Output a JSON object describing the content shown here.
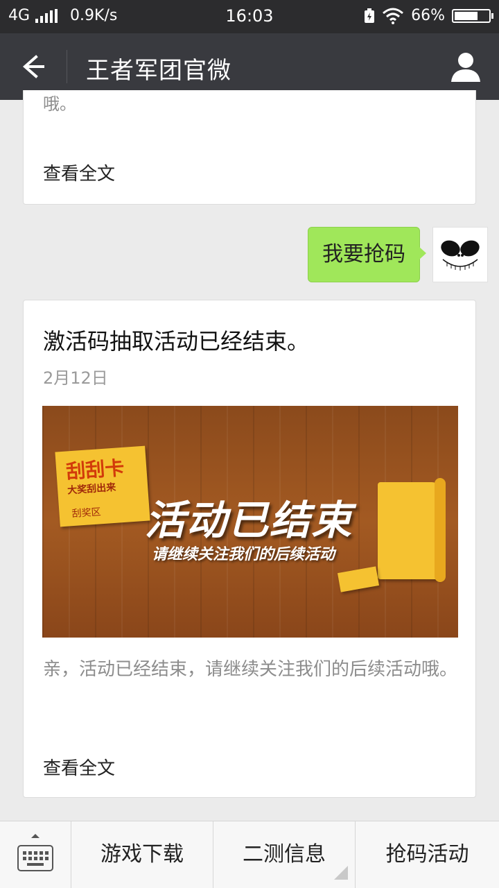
{
  "status_bar": {
    "network": "4G",
    "speed": "0.9K/s",
    "time": "16:03",
    "battery": "66%",
    "battery_level": 0.66
  },
  "header": {
    "title": "王者军团官微",
    "back_icon": "arrow-left-icon",
    "profile_icon": "person-icon"
  },
  "messages": {
    "prev_article": {
      "text_fragment": "哦。",
      "read_more": "查看全文"
    },
    "user_message": {
      "text": "我要抢码",
      "bubble_color": "#a0e75a"
    },
    "article": {
      "title": "激活码抽取活动已经结束。",
      "date": "2月12日",
      "banner": {
        "card_title": "刮刮卡",
        "card_subtitle": "大奖刮出来",
        "card_area": "刮奖区",
        "main_text": "活动已结束",
        "sub_text": "请继续关注我们的后续活动"
      },
      "description": "亲，活动已经结束，请继续关注我们的后续活动哦。",
      "read_more": "查看全文"
    }
  },
  "bottom_menu": {
    "keyboard_icon": "keyboard-icon",
    "items": [
      {
        "label": "游戏下载"
      },
      {
        "label": "二测信息"
      },
      {
        "label": "抢码活动"
      }
    ]
  }
}
